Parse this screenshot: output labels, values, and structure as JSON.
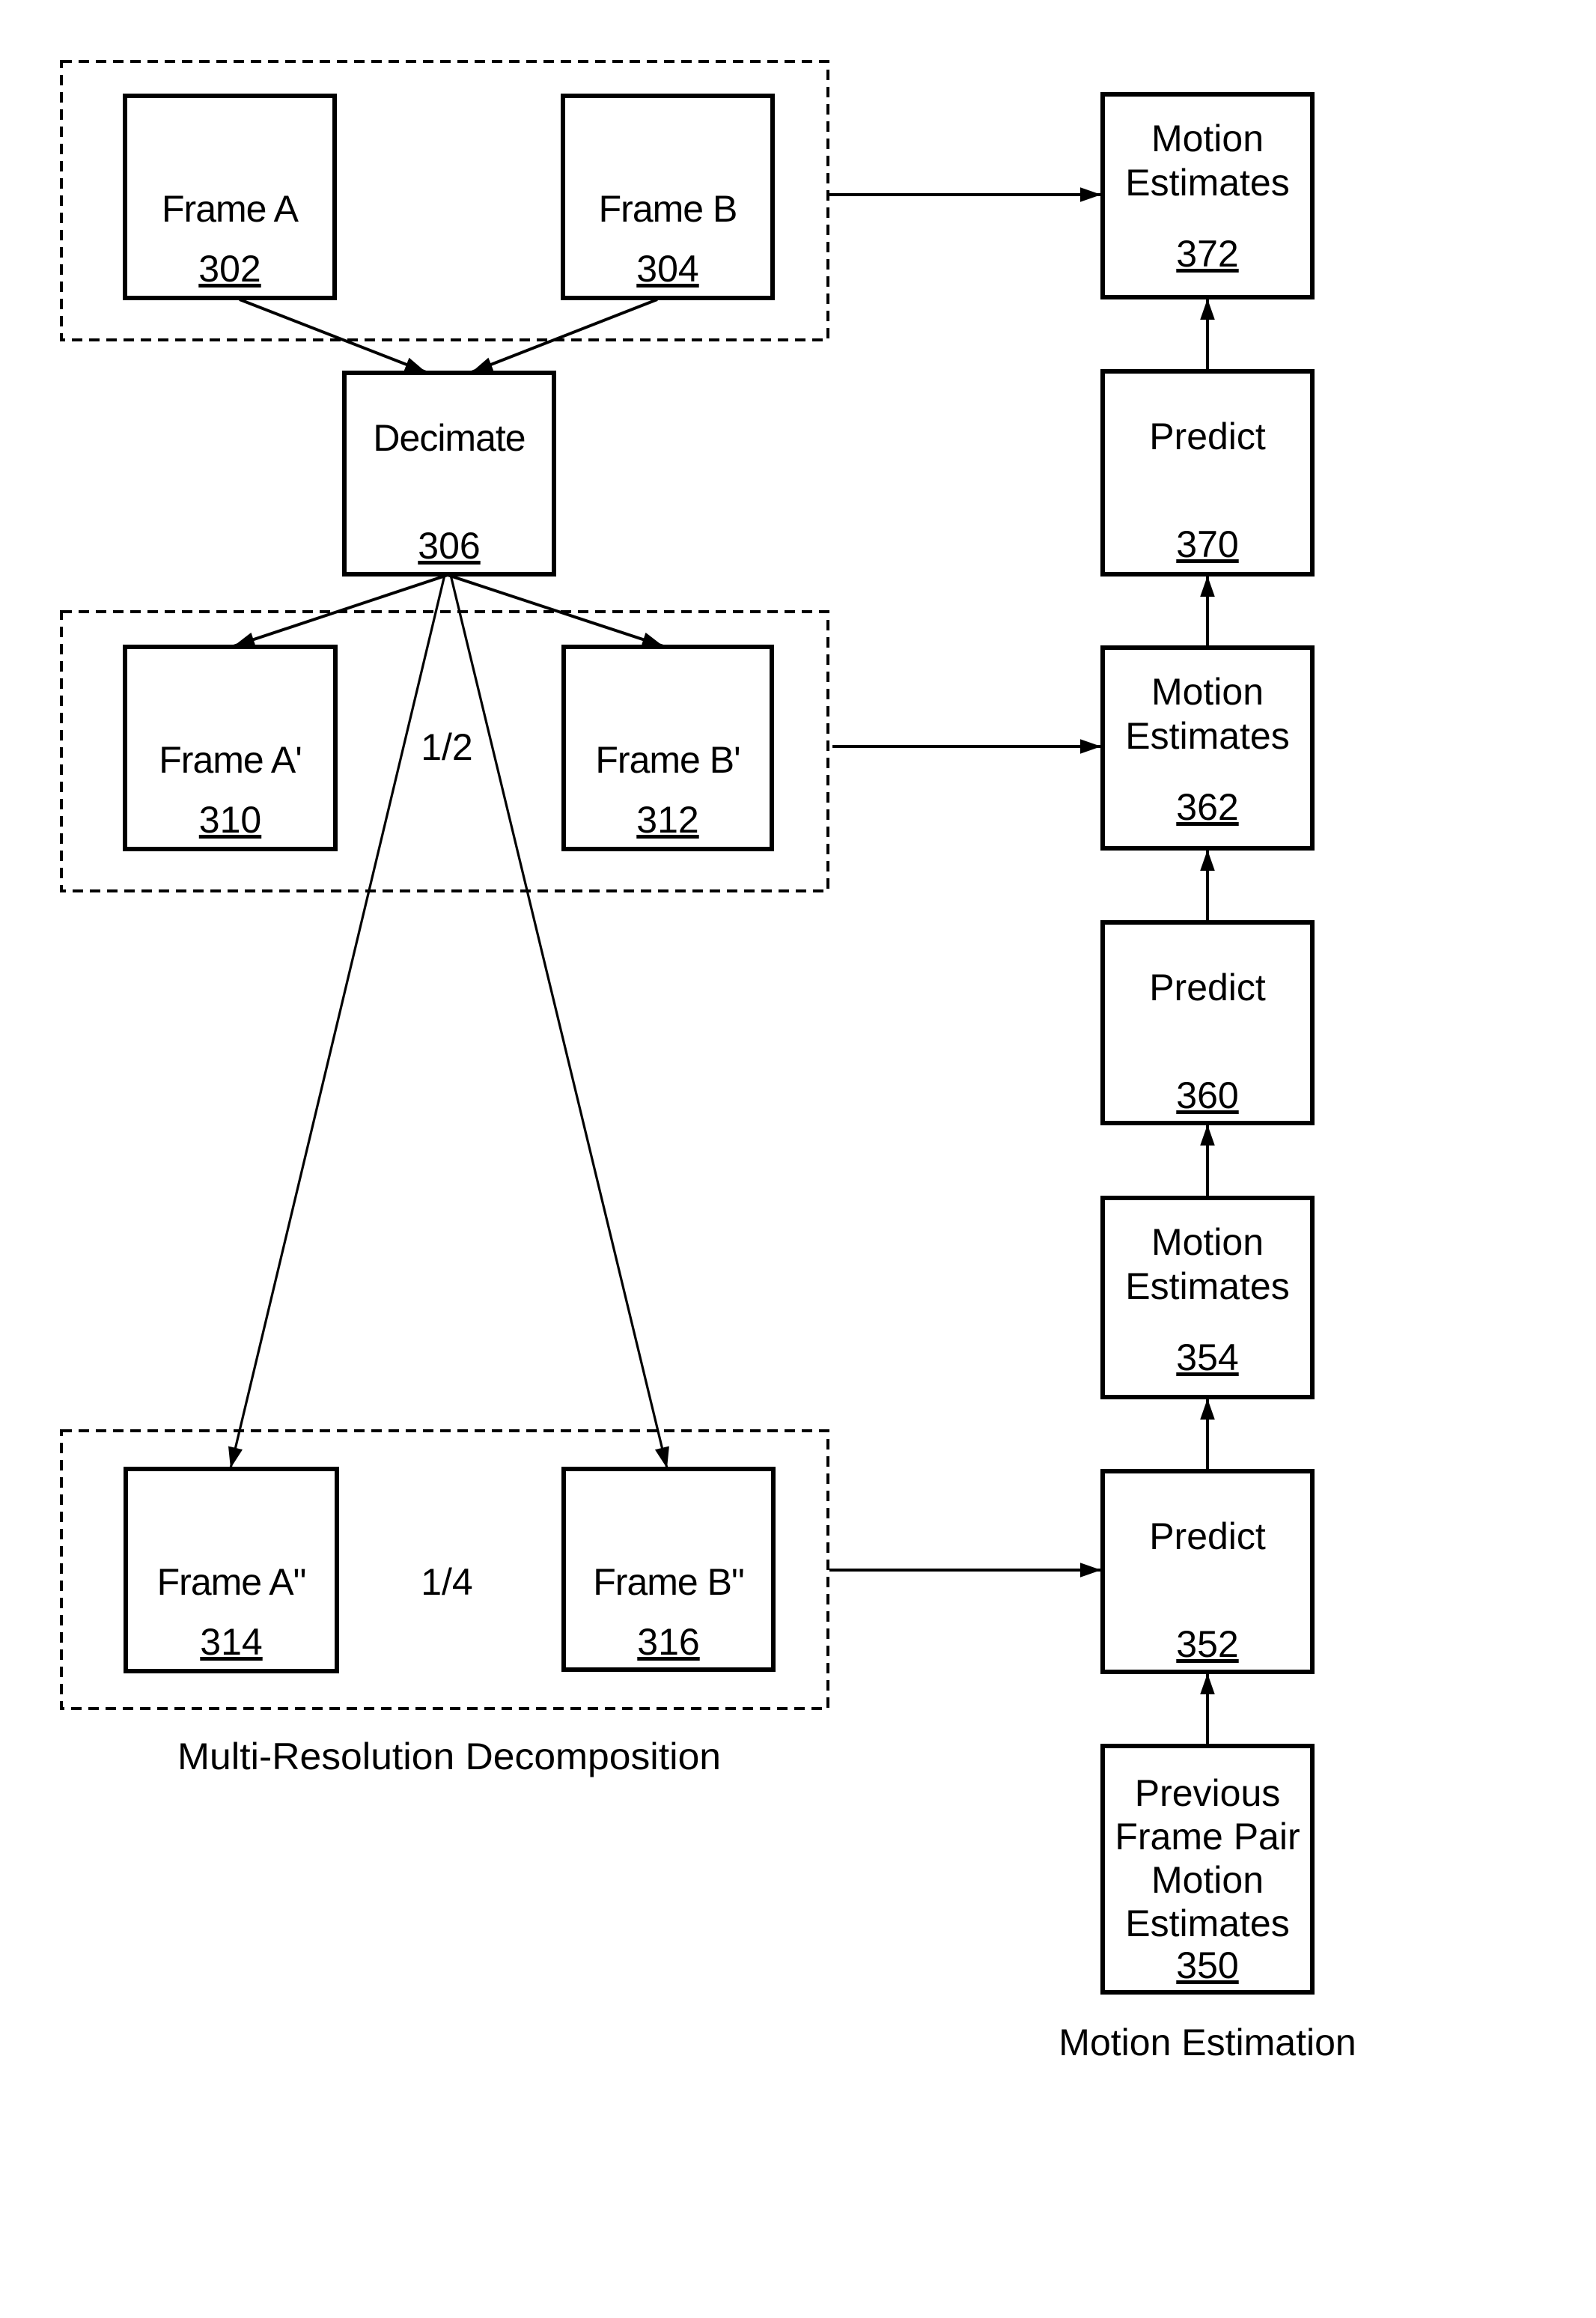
{
  "diagram": {
    "colors": {
      "ink": "#000000",
      "background": "#ffffff"
    },
    "groups": {
      "full_resolution": {
        "label": ""
      },
      "half_resolution": {
        "label": "1/2"
      },
      "quarter_resolution": {
        "label": "1/4"
      }
    },
    "nodes": {
      "frame_a": {
        "lines": [
          "Frame A"
        ],
        "ref": "302"
      },
      "frame_b": {
        "lines": [
          "Frame B"
        ],
        "ref": "304"
      },
      "decimate": {
        "lines": [
          "Decimate"
        ],
        "ref": "306"
      },
      "frame_a1": {
        "lines": [
          "Frame A'"
        ],
        "ref": "310"
      },
      "frame_b1": {
        "lines": [
          "Frame B'"
        ],
        "ref": "312"
      },
      "frame_a2": {
        "lines": [
          "Frame A\""
        ],
        "ref": "314"
      },
      "frame_b2": {
        "lines": [
          "Frame B\""
        ],
        "ref": "316"
      },
      "motion_372": {
        "lines": [
          "Motion",
          "Estimates"
        ],
        "ref": "372"
      },
      "predict_370": {
        "lines": [
          "Predict"
        ],
        "ref": "370"
      },
      "motion_362": {
        "lines": [
          "Motion",
          "Estimates"
        ],
        "ref": "362"
      },
      "predict_360": {
        "lines": [
          "Predict"
        ],
        "ref": "360"
      },
      "motion_354": {
        "lines": [
          "Motion",
          "Estimates"
        ],
        "ref": "354"
      },
      "predict_352": {
        "lines": [
          "Predict"
        ],
        "ref": "352"
      },
      "previous_350": {
        "lines": [
          "Previous",
          "Frame Pair",
          "Motion",
          "Estimates"
        ],
        "ref": "350"
      }
    },
    "edges": [
      {
        "from": "frame_a",
        "to": "decimate"
      },
      {
        "from": "frame_b",
        "to": "decimate"
      },
      {
        "from": "decimate",
        "to": "frame_a1"
      },
      {
        "from": "decimate",
        "to": "frame_b1"
      },
      {
        "from": "decimate",
        "to": "frame_a2"
      },
      {
        "from": "decimate",
        "to": "frame_b2"
      },
      {
        "from": "full_resolution",
        "to": "motion_372"
      },
      {
        "from": "half_resolution",
        "to": "motion_362"
      },
      {
        "from": "quarter_resolution",
        "to": "predict_352"
      },
      {
        "from": "previous_350",
        "to": "predict_352"
      },
      {
        "from": "predict_352",
        "to": "motion_354"
      },
      {
        "from": "motion_354",
        "to": "predict_360"
      },
      {
        "from": "predict_360",
        "to": "motion_362"
      },
      {
        "from": "motion_362",
        "to": "predict_370"
      },
      {
        "from": "predict_370",
        "to": "motion_372"
      }
    ],
    "captions": {
      "left": "Multi-Resolution Decomposition",
      "right": "Motion Estimation"
    }
  }
}
